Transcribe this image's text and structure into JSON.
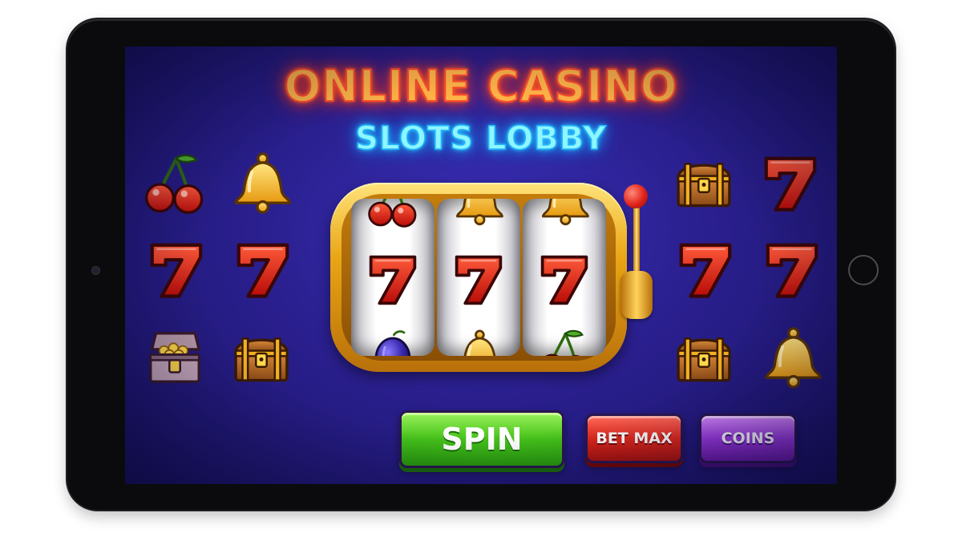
{
  "screen": {
    "title": "ONLINE CASINO",
    "subtitle": "SLOTS LOBBY"
  },
  "symbols": {
    "left_grid": [
      "cherry",
      "bell",
      "seven",
      "seven",
      "treasure-chest-open",
      "treasure-chest"
    ],
    "right_grid": [
      "treasure-chest",
      "seven",
      "seven",
      "seven",
      "treasure-chest",
      "bell"
    ]
  },
  "slot_machine": {
    "reels": [
      {
        "top": "cherry",
        "middle": "seven",
        "bottom": "plum"
      },
      {
        "top": "bell",
        "middle": "seven",
        "bottom": "bell"
      },
      {
        "top": "bell",
        "middle": "seven",
        "bottom": "cherry"
      }
    ]
  },
  "buttons": {
    "spin": "SPIN",
    "bet_max": "BET MAX",
    "coins": "COINS"
  },
  "colors": {
    "background": "#2a1f8e",
    "title_neon": "#ff7a2a",
    "subtitle_neon": "#36d6ff",
    "spin": "#45c21a",
    "bet_max": "#e0281c",
    "coins": "#9b3ae0"
  }
}
